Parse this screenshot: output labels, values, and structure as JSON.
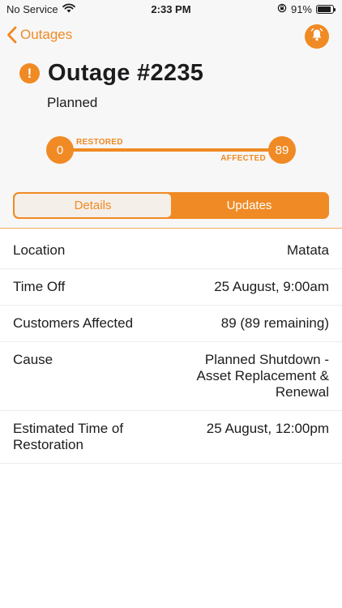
{
  "status_bar": {
    "carrier": "No Service",
    "time": "2:33 PM",
    "battery": "91%",
    "battery_level": 0.91
  },
  "nav": {
    "back_label": "Outages"
  },
  "outage": {
    "title": "Outage #2235",
    "status": "Planned",
    "restored_count": "0",
    "affected_count": "89",
    "restored_label": "RESTORED",
    "affected_label": "AFFECTED"
  },
  "tabs": [
    {
      "label": "Details",
      "active": true
    },
    {
      "label": "Updates",
      "active": false
    }
  ],
  "details": {
    "location": {
      "label": "Location",
      "value": "Matata"
    },
    "time_off": {
      "label": "Time Off",
      "value": "25 August, 9:00am"
    },
    "customers": {
      "label": "Customers Affected",
      "value": "89 (89 remaining)"
    },
    "cause": {
      "label": "Cause",
      "value": "Planned Shutdown - Asset Replacement & Renewal"
    },
    "etr": {
      "label": "Estimated Time of Restoration",
      "value": "25 August, 12:00pm"
    }
  },
  "colors": {
    "accent": "#f08a24",
    "background": "#f7f7f7",
    "text": "#1c1c1e"
  },
  "icons": [
    "wifi-icon",
    "orientation-lock-icon",
    "battery-icon",
    "chevron-left-icon",
    "bell-icon",
    "exclamation-icon"
  ]
}
